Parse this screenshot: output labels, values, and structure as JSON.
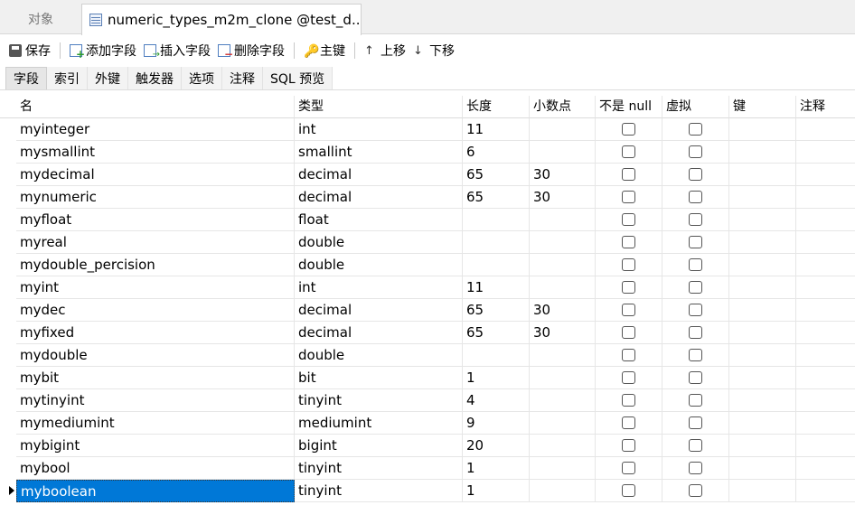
{
  "tabs": {
    "objects_label": "对象",
    "active_label": "numeric_types_m2m_clone @test_d..."
  },
  "toolbar": {
    "save": "保存",
    "add_field": "添加字段",
    "insert_field": "插入字段",
    "delete_field": "删除字段",
    "primary_key": "主键",
    "move_up": "上移",
    "move_down": "下移"
  },
  "subtabs": [
    "字段",
    "索引",
    "外键",
    "触发器",
    "选项",
    "注释",
    "SQL 预览"
  ],
  "columns": {
    "name": "名",
    "type": "类型",
    "length": "长度",
    "decimals": "小数点",
    "not_null": "不是 null",
    "virtual": "虚拟",
    "key": "键",
    "comment": "注释"
  },
  "rows": [
    {
      "name": "myinteger",
      "type": "int",
      "length": "11",
      "decimals": ""
    },
    {
      "name": "mysmallint",
      "type": "smallint",
      "length": "6",
      "decimals": ""
    },
    {
      "name": "mydecimal",
      "type": "decimal",
      "length": "65",
      "decimals": "30"
    },
    {
      "name": "mynumeric",
      "type": "decimal",
      "length": "65",
      "decimals": "30"
    },
    {
      "name": "myfloat",
      "type": "float",
      "length": "",
      "decimals": ""
    },
    {
      "name": "myreal",
      "type": "double",
      "length": "",
      "decimals": ""
    },
    {
      "name": "mydouble_percision",
      "type": "double",
      "length": "",
      "decimals": ""
    },
    {
      "name": "myint",
      "type": "int",
      "length": "11",
      "decimals": ""
    },
    {
      "name": "mydec",
      "type": "decimal",
      "length": "65",
      "decimals": "30"
    },
    {
      "name": "myfixed",
      "type": "decimal",
      "length": "65",
      "decimals": "30"
    },
    {
      "name": "mydouble",
      "type": "double",
      "length": "",
      "decimals": ""
    },
    {
      "name": "mybit",
      "type": "bit",
      "length": "1",
      "decimals": ""
    },
    {
      "name": "mytinyint",
      "type": "tinyint",
      "length": "4",
      "decimals": ""
    },
    {
      "name": "mymediumint",
      "type": "mediumint",
      "length": "9",
      "decimals": ""
    },
    {
      "name": "mybigint",
      "type": "bigint",
      "length": "20",
      "decimals": ""
    },
    {
      "name": "mybool",
      "type": "tinyint",
      "length": "1",
      "decimals": ""
    },
    {
      "name": "myboolean",
      "type": "tinyint",
      "length": "1",
      "decimals": ""
    }
  ],
  "selected_row": 16,
  "colors": {
    "selection": "#0078d7"
  }
}
